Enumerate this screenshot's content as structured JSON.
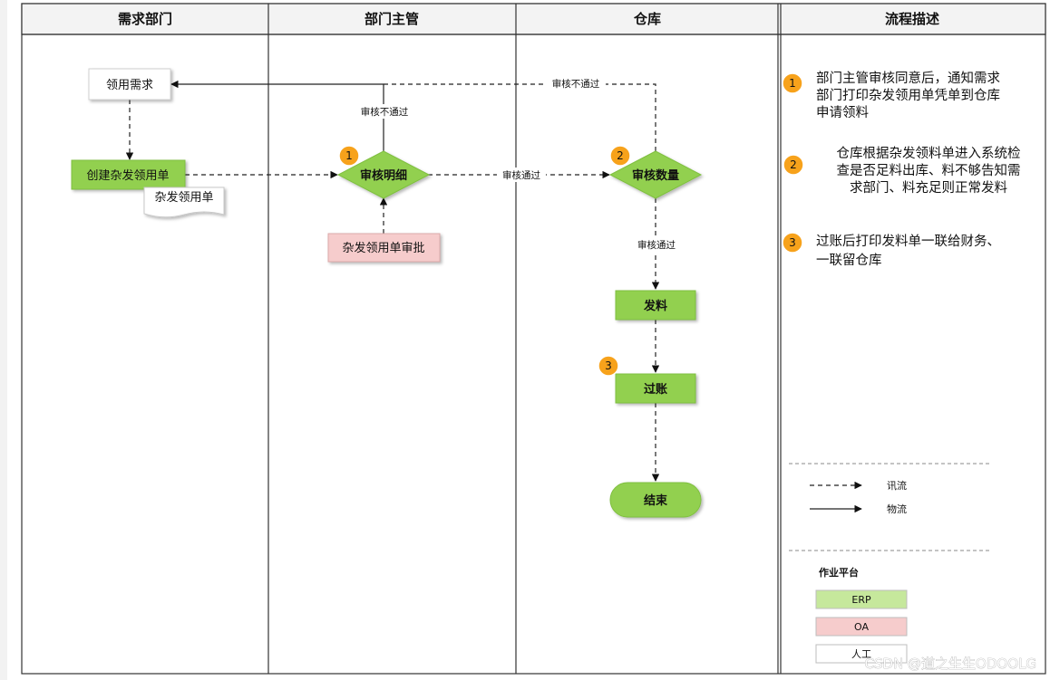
{
  "lanes": [
    {
      "id": "demand",
      "title": "需求部门"
    },
    {
      "id": "manager",
      "title": "部门主管"
    },
    {
      "id": "warehouse",
      "title": "仓库"
    },
    {
      "id": "description",
      "title": "流程描述"
    }
  ],
  "nodes": {
    "need": "领用需求",
    "create": "创建杂发领用单",
    "doc": "杂发领用单",
    "review_detail": "审核明细",
    "approval": "杂发领用单审批",
    "review_qty": "审核数量",
    "issue": "发料",
    "post": "过账",
    "end": "结束"
  },
  "edge_labels": {
    "reject_manager": "审核不通过",
    "reject_warehouse": "审核不通过",
    "pass_manager": "审核通过",
    "pass_warehouse": "审核通过"
  },
  "badges": [
    "1",
    "2",
    "3"
  ],
  "description": {
    "steps": [
      {
        "num": "1",
        "lines": [
          "部门主管审核同意后，通知需求",
          "部门打印杂发领用单凭单到仓库",
          "申请领料"
        ]
      },
      {
        "num": "2",
        "lines": [
          "仓库根据杂发领料单进入系统检",
          "查是否足料出库、料不够告知需",
          "求部门、料充足则正常发料"
        ]
      },
      {
        "num": "3",
        "lines": [
          "过账后打印发料单一联给财务、",
          "一联留仓库"
        ]
      }
    ]
  },
  "legend": {
    "info_flow": "讯流",
    "material_flow": "物流",
    "platform_title": "作业平台",
    "platforms": [
      {
        "label": "ERP",
        "color": "#c6e89c"
      },
      {
        "label": "OA",
        "color": "#f6cccc"
      },
      {
        "label": "人工",
        "color": "#ffffff"
      }
    ]
  },
  "watermark": "CSDN @道之生生ODOOLG",
  "colors": {
    "green": "#92d050",
    "green_light": "#c6e89c",
    "pink": "#f6cccc",
    "badge": "#f7a21b",
    "line": "#222222"
  }
}
